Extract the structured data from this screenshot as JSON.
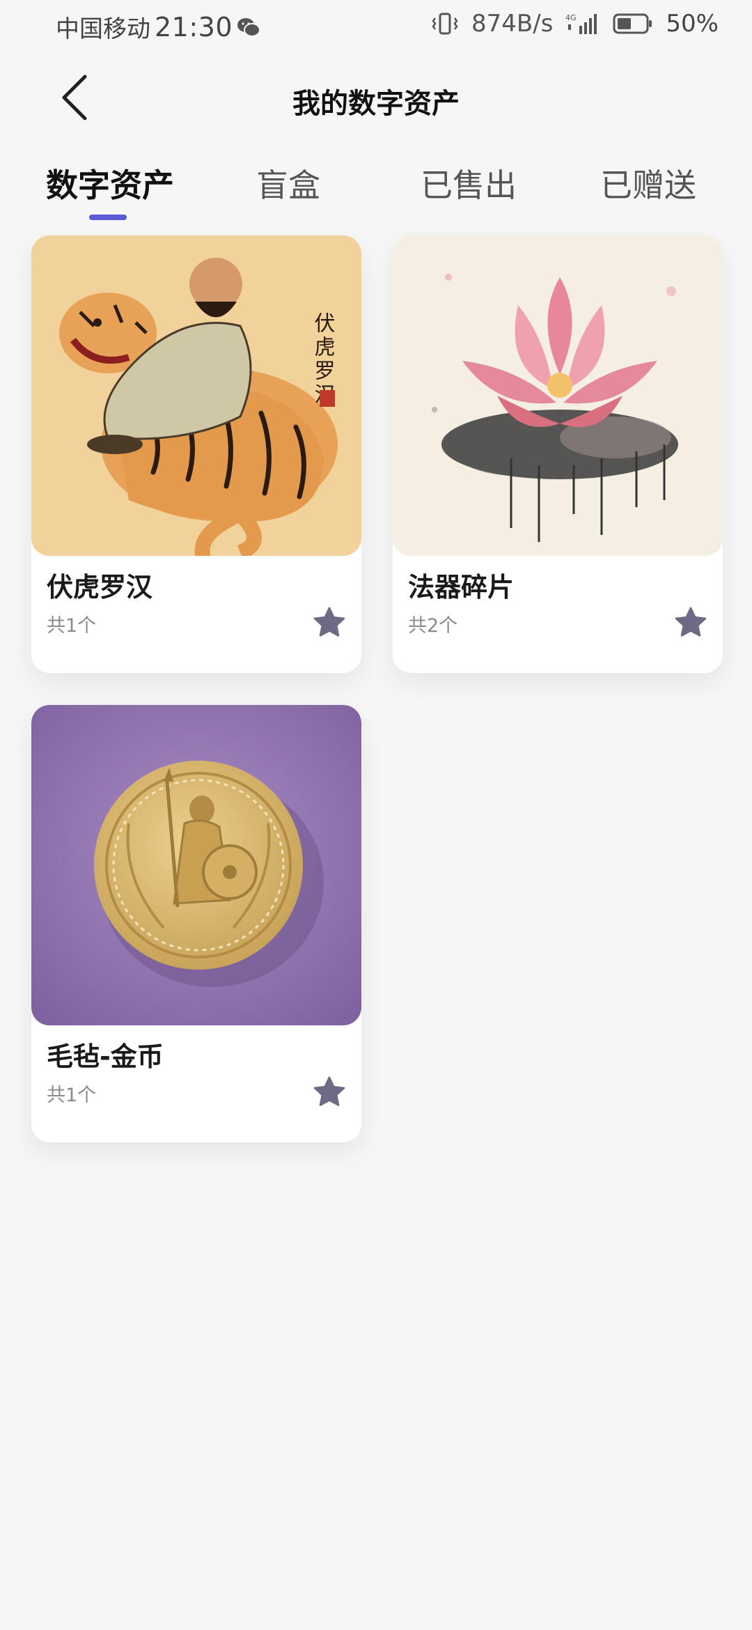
{
  "status_bar": {
    "carrier": "中国移动",
    "time": "21:30",
    "net_speed": "874B/s",
    "network": "4G",
    "battery": "50%",
    "icons": [
      "wechat-icon",
      "vibrate-icon",
      "signal-icon",
      "battery-icon"
    ]
  },
  "header": {
    "title": "我的数字资产",
    "back_icon": "chevron-left-icon"
  },
  "tabs": [
    {
      "label": "数字资产",
      "active": true
    },
    {
      "label": "盲盒",
      "active": false
    },
    {
      "label": "已售出",
      "active": false
    },
    {
      "label": "已赠送",
      "active": false
    }
  ],
  "assets": [
    {
      "name": "伏虎罗汉",
      "count": "共1个",
      "image": "tiger-arhat-painting",
      "image_caption": "伏虎罗汉",
      "star_icon": "star-icon"
    },
    {
      "name": "法器碎片",
      "count": "共2个",
      "image": "lotus-ink-painting",
      "star_icon": "star-icon"
    },
    {
      "name": "毛毡-金币",
      "count": "共1个",
      "image": "felt-gold-coin",
      "star_icon": "star-icon"
    }
  ],
  "colors": {
    "accent": "#5b5bd6",
    "star": "#6e6a86",
    "background": "#f6f6f6"
  }
}
